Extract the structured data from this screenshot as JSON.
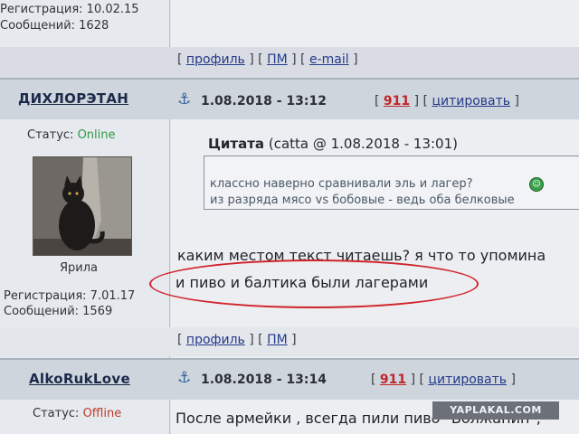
{
  "prev_post": {
    "registration": "Регистрация: 10.02.15",
    "messages": "Сообщений: 1628",
    "actions": {
      "profile": "профиль",
      "pm": "ПМ",
      "email": "e-mail"
    }
  },
  "post1": {
    "username": "ДИХЛОРЭТАН",
    "date": "1.08.2018 - 13:12",
    "rating": "911",
    "quote_action": "цитировать",
    "status_label": "Статус:",
    "status_value": "Online",
    "avatar_caption": "Ярила",
    "registration": "Регистрация: 7.01.17",
    "messages": "Сообщений: 1569",
    "quote": {
      "title": "Цитата",
      "meta": "(catta @ 1.08.2018 - 13:01)",
      "lines": [
        "классно наверно сравнивали эль и лагер?",
        "из разряда мясо vs бобовые - ведь оба белковые"
      ]
    },
    "body": [
      "каким местом текст читаешь? я что то упомина",
      "и пиво и балтика были лагерами"
    ],
    "actions": {
      "profile": "профиль",
      "pm": "ПМ"
    }
  },
  "post2": {
    "username": "AlkoRukLove",
    "date": "1.08.2018 - 13:14",
    "rating": "911",
    "quote_action": "цитировать",
    "status_label": "Статус:",
    "status_value": "Offline",
    "body": "После армейки , всегда пили пиво \"Волжанин\","
  },
  "watermark": "YAPLAKAL.COM",
  "colors": {
    "online": "#2f9a44",
    "offline": "#c0392b",
    "highlight_oval": "#d0232a",
    "link": "#233a8a"
  }
}
